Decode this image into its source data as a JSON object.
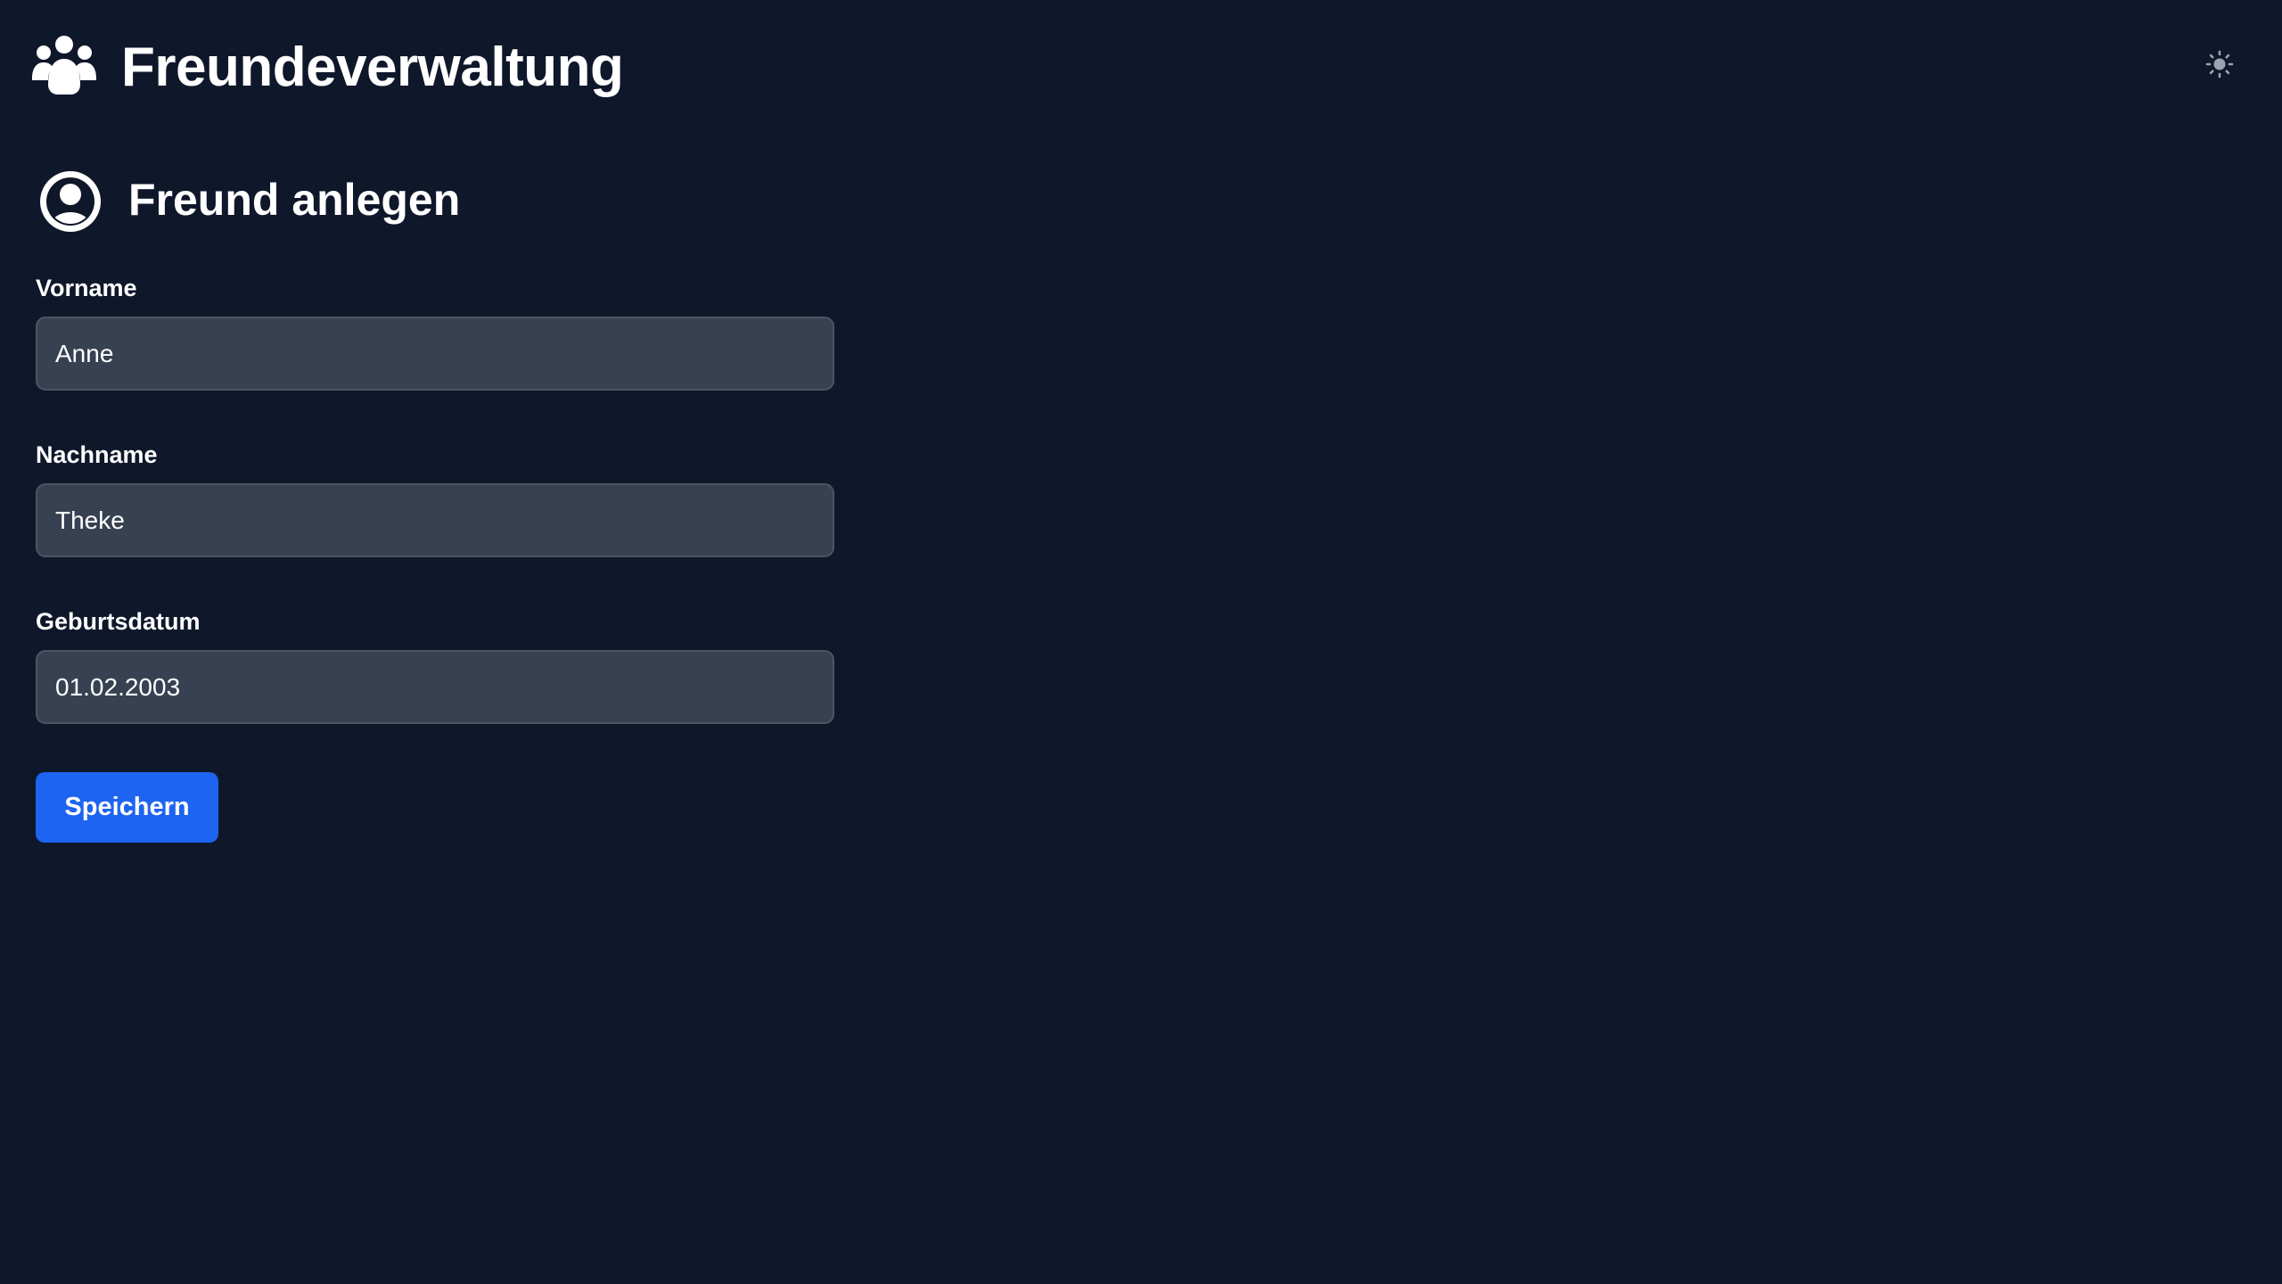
{
  "header": {
    "title": "Freundeverwaltung",
    "logo_icon": "users-group-icon",
    "theme_toggle_icon": "sun-icon"
  },
  "form": {
    "title": "Freund anlegen",
    "title_icon": "user-circle-icon",
    "fields": [
      {
        "label": "Vorname",
        "value": "Anne"
      },
      {
        "label": "Nachname",
        "value": "Theke"
      },
      {
        "label": "Geburtsdatum",
        "value": "01.02.2003"
      }
    ],
    "save_label": "Speichern"
  },
  "colors": {
    "background": "#0f172a",
    "input_background": "#374151",
    "input_border": "#4b5563",
    "primary_button": "#1d64f0",
    "text": "#ffffff"
  }
}
